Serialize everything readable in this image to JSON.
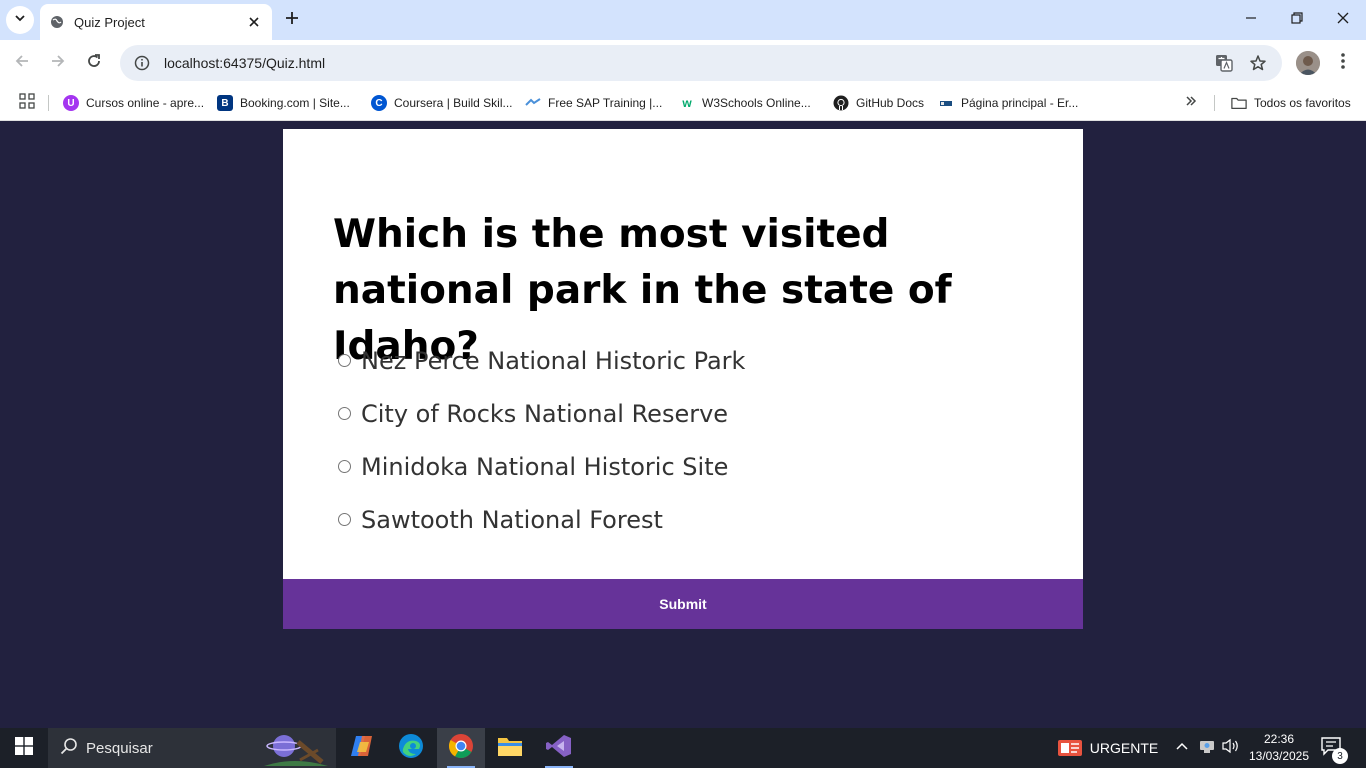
{
  "browser": {
    "tab": {
      "title": "Quiz Project"
    },
    "address": {
      "url": "localhost:64375/Quiz.html"
    },
    "bookmarks": [
      {
        "label": "Cursos online - apre...",
        "icon": "udemy-icon",
        "color": "#a435f0"
      },
      {
        "label": "Booking.com | Site...",
        "icon": "booking-icon",
        "color": "#003580"
      },
      {
        "label": "Coursera | Build Skil...",
        "icon": "coursera-icon",
        "color": "#0056d2"
      },
      {
        "label": "Free SAP Training |...",
        "icon": "sap-icon",
        "color": "#4a90d9"
      },
      {
        "label": "W3Schools Online...",
        "icon": "w3schools-icon",
        "color": "#04aa6d"
      },
      {
        "label": "GitHub Docs",
        "icon": "github-icon",
        "color": "#1f1f1f"
      },
      {
        "label": "Página principal - Er...",
        "icon": "page-icon",
        "color": "#1a4d80"
      }
    ],
    "all_bookmarks": "Todos os favoritos"
  },
  "quiz": {
    "question": "Which is the most visited national park in the state of Idaho?",
    "answers": [
      "Nez Perce National Historic Park",
      "City of Rocks National Reserve",
      "Minidoka National Historic Site",
      "Sawtooth National Forest"
    ],
    "submit_label": "Submit"
  },
  "taskbar": {
    "search_placeholder": "Pesquisar",
    "tray_label": "URGENTE",
    "time": "22:36",
    "date": "13/03/2025",
    "notification_count": "3"
  },
  "colors": {
    "page_background": "#22213f",
    "submit_background": "#663399"
  }
}
